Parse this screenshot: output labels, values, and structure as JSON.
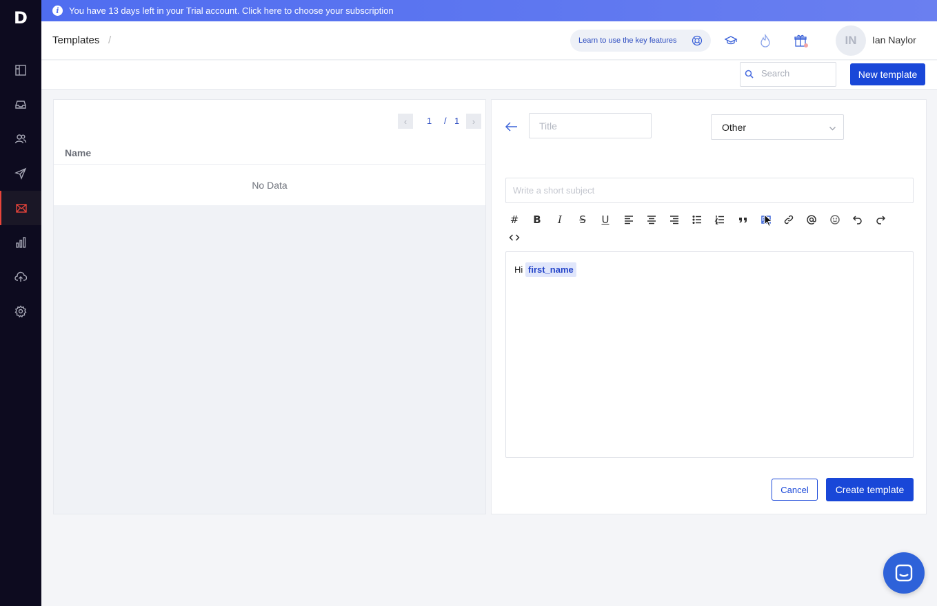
{
  "app": {
    "logo": "D"
  },
  "sidebar": {
    "items": [
      {
        "icon": "layout-icon"
      },
      {
        "icon": "inbox-icon"
      },
      {
        "icon": "contacts-icon"
      },
      {
        "icon": "send-icon"
      },
      {
        "icon": "templates-icon",
        "active": true
      },
      {
        "icon": "analytics-icon"
      },
      {
        "icon": "upload-icon"
      },
      {
        "icon": "settings-icon"
      }
    ]
  },
  "banner": {
    "icon": "i",
    "text": "You have 13 days left in your Trial account. Click here to choose your subscription"
  },
  "header": {
    "breadcrumb": "Templates",
    "separator": "/",
    "learn_label": "Learn to use the key features",
    "user": {
      "initials": "IN",
      "name": "Ian Naylor"
    }
  },
  "toolbar": {
    "search_placeholder": "Search",
    "new_template_label": "New template"
  },
  "list": {
    "pagination": {
      "prev": "‹",
      "current": "1",
      "sep": "/",
      "total": "1",
      "next": "›"
    },
    "column_name": "Name",
    "empty_text": "No Data"
  },
  "editor": {
    "title_placeholder": "Title",
    "category_value": "Other",
    "subject_placeholder": "Write a short subject",
    "toolbar": {
      "heading": "#",
      "bold": "B",
      "italic": "I",
      "strike": "S",
      "underline": "U"
    },
    "body_greeting": "Hi",
    "body_tag": "first_name",
    "cancel_label": "Cancel",
    "create_label": "Create template"
  },
  "colors": {
    "accent": "#1947d8",
    "sidebar_bg": "#0d0b1f",
    "active_red": "#e8443a"
  }
}
